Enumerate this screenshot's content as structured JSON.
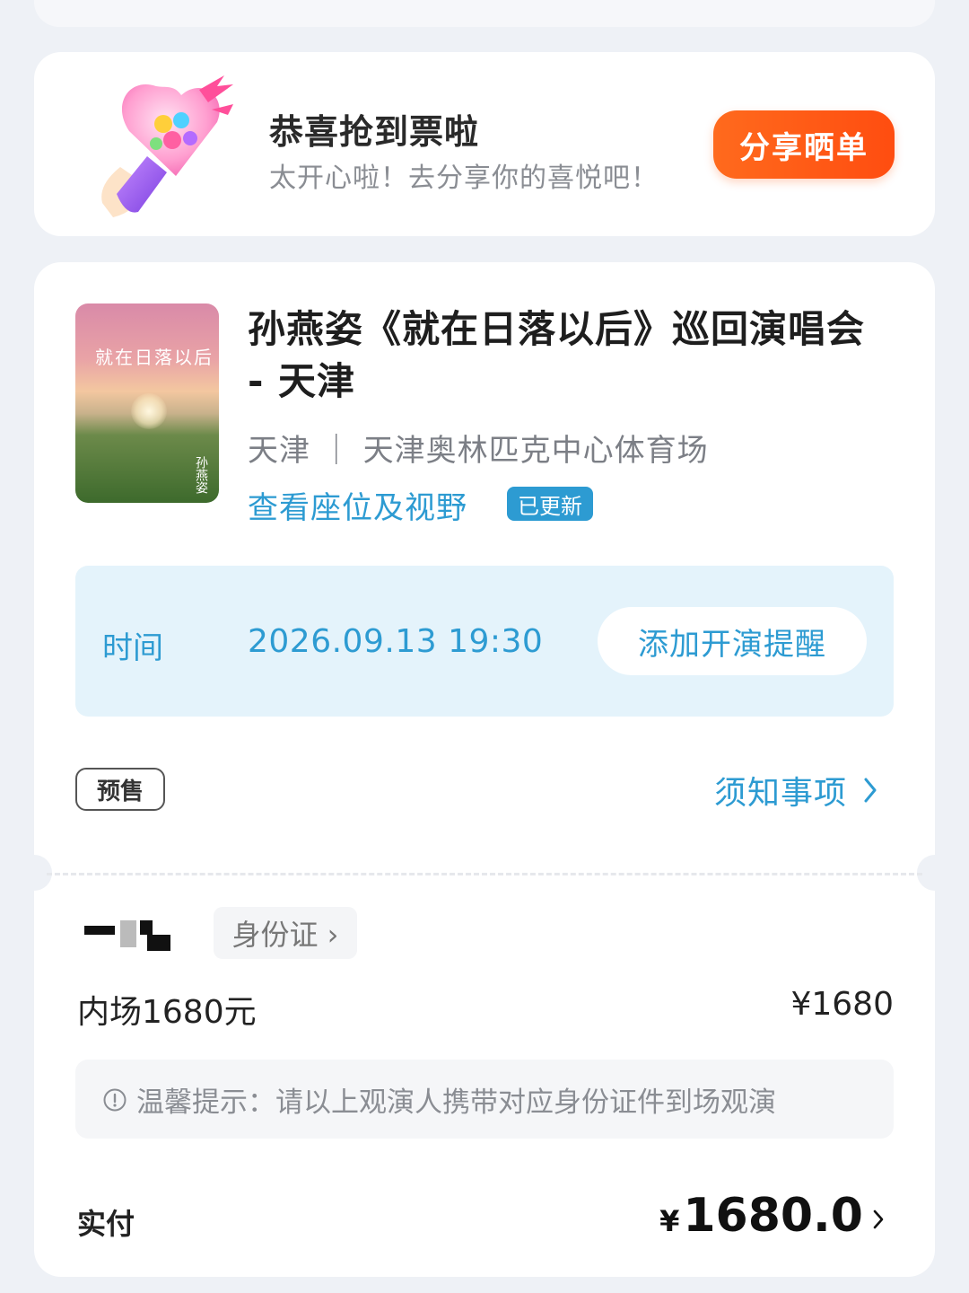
{
  "congrats": {
    "title": "恭喜抢到票啦",
    "subtitle": "太开心啦！去分享你的喜悦吧！",
    "share_button": "分享晒单",
    "gift_icon": "lightstick-gift-icon"
  },
  "event": {
    "poster_title": "就在日落以后",
    "poster_artist": "孙燕姿",
    "title": "孙燕姿《就在日落以后》巡回演唱会 - 天津",
    "venue": "天津 ｜ 天津奥林匹克中心体育场",
    "seat_link": "查看座位及视野",
    "updated_badge": "已更新"
  },
  "schedule": {
    "label": "时间",
    "datetime": "2026.09.13 19:30",
    "remind_button": "添加开演提醒"
  },
  "tags": {
    "presale": "预售",
    "notice_link": "须知事项"
  },
  "buyer": {
    "id_type": "身份证 ›",
    "ticket_name": "内场1680元",
    "ticket_price": "¥1680"
  },
  "tip": {
    "text": "温馨提示：请以上观演人携带对应身份证件到场观演"
  },
  "payment": {
    "label": "实付",
    "currency": "¥",
    "amount": "1680.0"
  },
  "colors": {
    "accent_blue": "#2d9bd2",
    "share_orange": "#ff5a16",
    "background": "#eef1f6"
  }
}
